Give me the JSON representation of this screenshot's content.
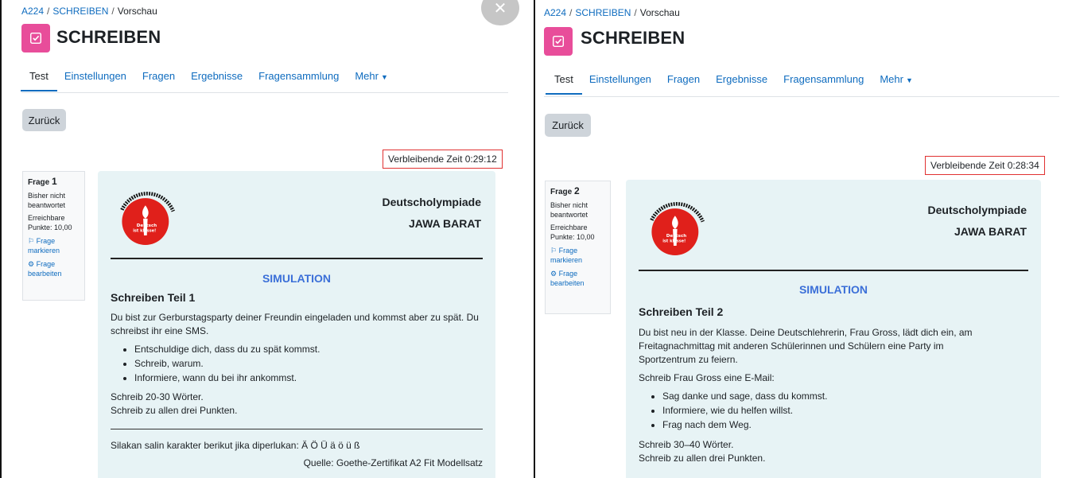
{
  "left": {
    "breadcrumb": [
      "A224",
      "SCHREIBEN",
      "Vorschau"
    ],
    "title": "SCHREIBEN",
    "tabs": [
      "Test",
      "Einstellungen",
      "Fragen",
      "Ergebnisse",
      "Fragensammlung",
      "Mehr"
    ],
    "back_label": "Zurück",
    "timer": "Verbleibende Zeit 0:29:12",
    "qinfo": {
      "frage_label": "Frage",
      "frage_num": "1",
      "status": "Bisher nicht beantwortet",
      "points": "Erreichbare Punkte: 10,00",
      "flag": "Frage markieren",
      "edit": "Frage bearbeiten"
    },
    "org1": "Deutscholympiade",
    "org2": "JAWA BARAT",
    "simulation": "SIMULATION",
    "teil": "Schreiben Teil 1",
    "intro": "Du bist zur Gerburstagsparty deiner Freundin eingeladen und kommst aber zu spät. Du schreibst ihr eine SMS.",
    "bullets": [
      "Entschuldige dich, dass du zu spät kommst.",
      "Schreib, warum.",
      "Informiere, wann du bei ihr ankommst."
    ],
    "words": "Schreib 20-30 Wörter.",
    "all_points": "Schreib zu allen drei Punkten.",
    "chars": "Silakan salin karakter berikut jika diperlukan: Ä Ö Ü ä ö ü ß",
    "source": "Quelle: Goethe-Zertifikat A2 Fit Modellsatz"
  },
  "right": {
    "breadcrumb": [
      "A224",
      "SCHREIBEN",
      "Vorschau"
    ],
    "title": "SCHREIBEN",
    "tabs": [
      "Test",
      "Einstellungen",
      "Fragen",
      "Ergebnisse",
      "Fragensammlung",
      "Mehr"
    ],
    "back_label": "Zurück",
    "timer": "Verbleibende Zeit 0:28:34",
    "qinfo": {
      "frage_label": "Frage",
      "frage_num": "2",
      "status": "Bisher nicht beantwortet",
      "points": "Erreichbare Punkte: 10,00",
      "flag": "Frage markieren",
      "edit": "Frage bearbeiten"
    },
    "org1": "Deutscholympiade",
    "org2": "JAWA BARAT",
    "simulation": "SIMULATION",
    "teil": "Schreiben Teil 2",
    "intro": "Du bist neu in der Klasse. Deine Deutschlehrerin, Frau Gross, lädt dich ein, am Freitagnachmittag mit anderen Schülerinnen und Schülern eine Party im Sportzentrum zu feiern.",
    "intro2": "Schreib Frau Gross eine E-Mail:",
    "bullets": [
      "Sag danke und sage, dass du kommst.",
      "Informiere, wie du helfen willst.",
      "Frag nach dem Weg."
    ],
    "words": "Schreib 30–40 Wörter.",
    "all_points": "Schreib zu allen drei Punkten."
  },
  "logo": {
    "arc_text": "Nationale Deutscholympiade in Indonesien",
    "badge_line1": "Deutsch",
    "badge_line2": "ist klasse!"
  },
  "colors": {
    "accent": "#0f6cbf",
    "icon_bg": "#e84d9a",
    "timer_border": "#e03131",
    "simulation": "#3b6fd8",
    "card_bg": "#e7f3f5",
    "logo_red": "#e0201b"
  }
}
